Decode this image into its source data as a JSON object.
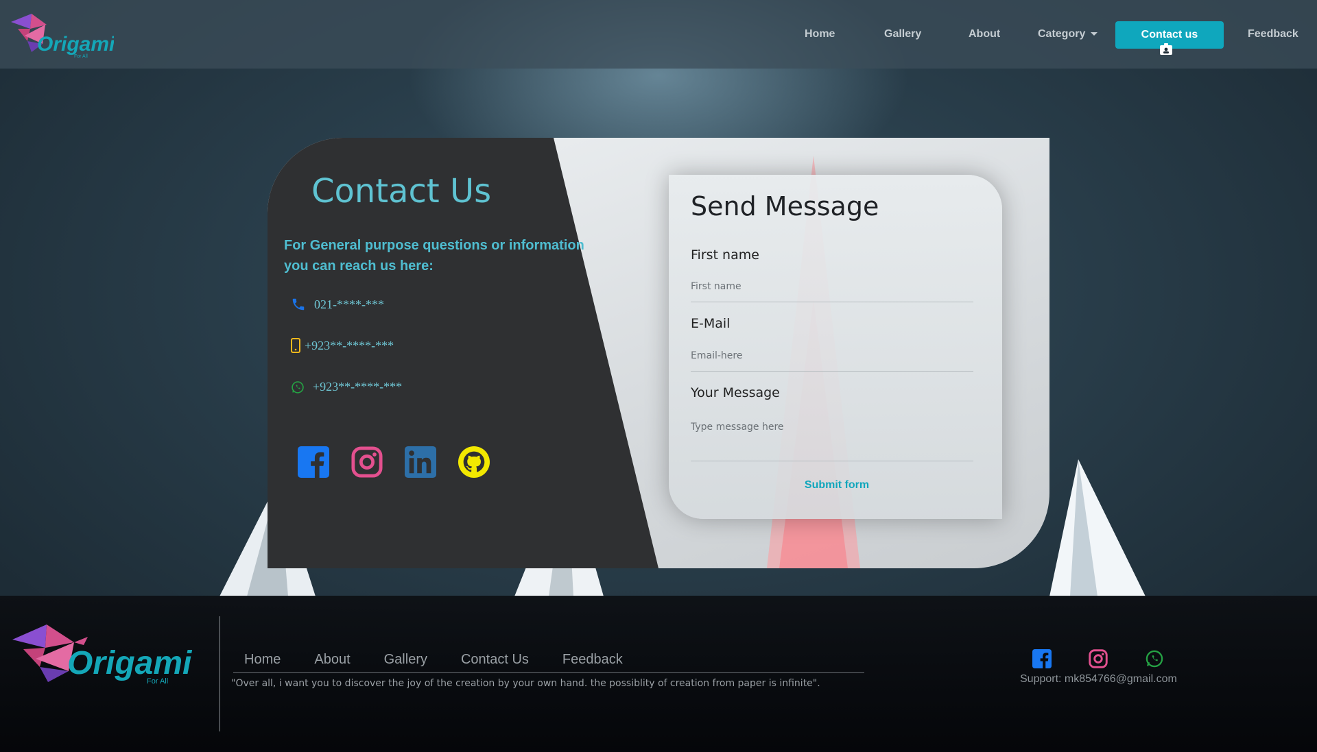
{
  "brand": {
    "logo_text": "Origami",
    "logo_tagline": "For All"
  },
  "navbar": {
    "home": "Home",
    "gallery": "Gallery",
    "about": "About",
    "category": "Category",
    "contact": "Contact us",
    "feedback": "Feedback"
  },
  "contact": {
    "title": "Contact Us",
    "subtitle_line1": "For General purpose questions or information",
    "subtitle_line2": "you can reach us here:",
    "phones": [
      {
        "icon": "phone-icon",
        "number": "021-****-***"
      },
      {
        "icon": "mobile-icon",
        "number": "+923**-****-***"
      },
      {
        "icon": "whatsapp-icon",
        "number": "+923**-****-***"
      }
    ],
    "socials": [
      "facebook-icon",
      "instagram-icon",
      "linkedin-icon",
      "github-icon"
    ]
  },
  "form": {
    "title": "Send Message",
    "first_name_label": "First name",
    "first_name_placeholder": "First name",
    "email_label": "E-Mail",
    "email_placeholder": "Email-here",
    "message_label": "Your Message",
    "message_placeholder": "Type message here",
    "submit": "Submit form"
  },
  "footer": {
    "nav": [
      "Home",
      "About",
      "Gallery",
      "Contact Us",
      "Feedback"
    ],
    "quote": "\"Over all, i want you to discover the joy of the creation by your own hand. the possiblity of creation from paper is infinite\".",
    "support": "Support: mk854766@gmail.com"
  },
  "colors": {
    "accent": "#0fa7bd",
    "title_teal": "#5fc3d2",
    "card_dark": "#2f3032",
    "facebook": "#1877f2",
    "instagram": "#e4508f",
    "linkedin": "#2d6fa8",
    "github": "#f2e800",
    "whatsapp": "#25a244",
    "mobile": "#f3b81b"
  }
}
